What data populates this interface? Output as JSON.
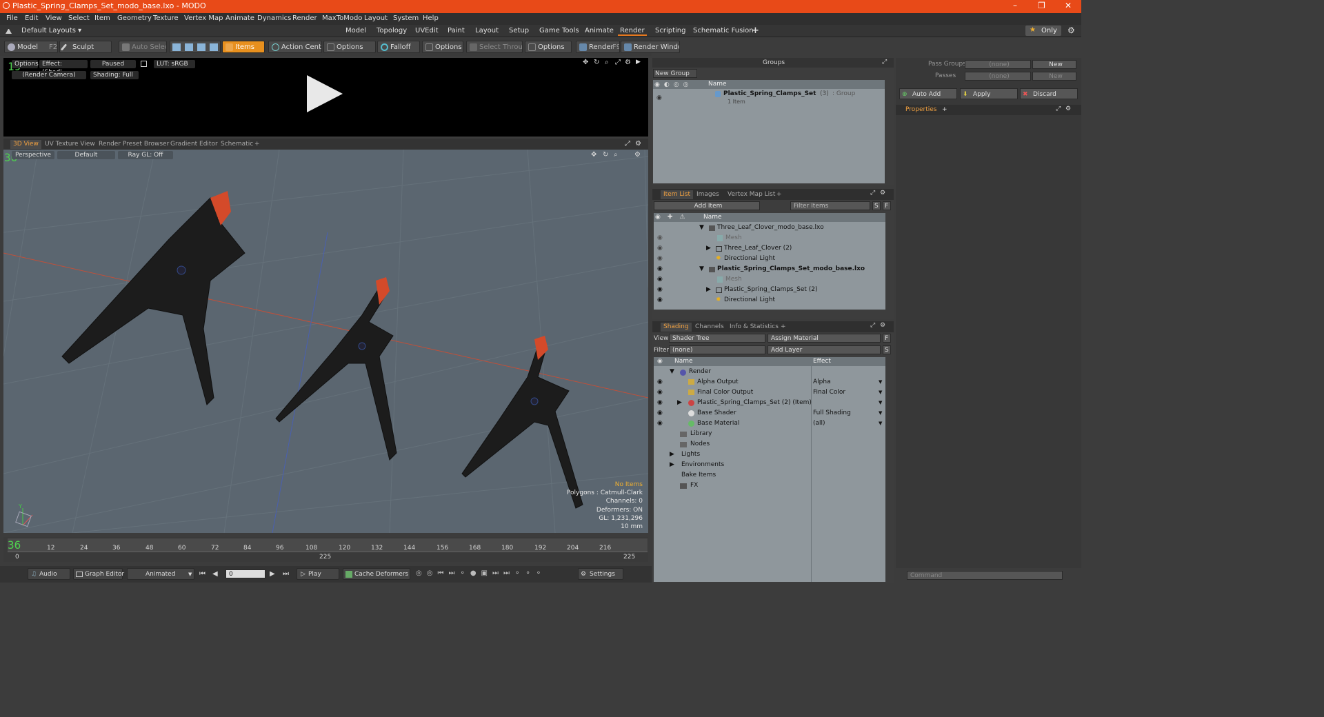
{
  "window": {
    "title": "Plastic_Spring_Clamps_Set_modo_base.lxo - MODO",
    "minimize": "–",
    "restore": "❐",
    "close": "✕"
  },
  "menu": [
    "File",
    "Edit",
    "View",
    "Select",
    "Item",
    "Geometry",
    "Texture",
    "Vertex Map",
    "Animate",
    "Dynamics",
    "Render",
    "MaxToModo",
    "Layout",
    "System",
    "Help"
  ],
  "layouts": {
    "label": "Default Layouts ▾",
    "tabs": [
      "Model",
      "Topology",
      "UVEdit",
      "Paint",
      "Layout",
      "Setup",
      "Game Tools",
      "Animate",
      "Render",
      "Scripting",
      "Schematic Fusion"
    ],
    "active": "Render",
    "only": "Only",
    "add": "+"
  },
  "toolbar": {
    "model": "Model",
    "model_key": "F2",
    "sculpt": "Sculpt",
    "auto_select": "Auto Select",
    "items": "Items",
    "action_center": "Action Center",
    "options1": "Options",
    "falloff": "Falloff",
    "options2": "Options",
    "select_through": "Select Through",
    "options3": "Options",
    "render": "Render",
    "render_key": "F9",
    "render_window": "Render Window"
  },
  "render_view": {
    "options": "Options",
    "effect": "Effect: (Shadi...",
    "paused": "Paused",
    "lut": "LUT: sRGB",
    "camera": "(Render Camera)",
    "shading": "Shading: Full"
  },
  "viewport_tabs": [
    "3D View",
    "UV Texture View",
    "Render Preset Browser",
    "Gradient Editor",
    "Schematic",
    "+"
  ],
  "viewport": {
    "perspective": "Perspective",
    "default": "Default",
    "raygl": "Ray GL: Off",
    "no_items": "No Items",
    "polygons": "Polygons : Catmull-Clark",
    "channels": "Channels: 0",
    "deformers": "Deformers: ON",
    "gl": "GL: 1,231,296",
    "mm": "10 mm",
    "axis_y": "Y"
  },
  "timeline": {
    "ticks": [
      "12",
      "24",
      "36",
      "48",
      "60",
      "72",
      "84",
      "96",
      "108",
      "120",
      "132",
      "144",
      "156",
      "168",
      "180",
      "192",
      "204",
      "216"
    ],
    "start": "0",
    "mid": "225",
    "end": "225"
  },
  "bottombar": {
    "audio": "Audio",
    "graph_editor": "Graph Editor",
    "animated": "Animated",
    "frame": "0",
    "play": "Play",
    "cache": "Cache Deformers",
    "settings": "Settings"
  },
  "groups": {
    "title": "Groups",
    "new_group": "New Group",
    "col_name": "Name",
    "item": "Plastic_Spring_Clamps_Set",
    "count": "(3)",
    "type": ": Group",
    "sub": "1 Item"
  },
  "passes": {
    "pass_groups": "Pass Groups",
    "passes": "Passes",
    "none": "(none)",
    "new": "New",
    "auto_add": "Auto Add",
    "apply": "Apply",
    "discard": "Discard",
    "properties": "Properties",
    "plus": "+"
  },
  "item_list": {
    "tabs": [
      "Item List",
      "Images",
      "Vertex Map List",
      "+"
    ],
    "add_item": "Add Item",
    "filter": "Filter Items",
    "s": "S",
    "f": "F",
    "col_name": "Name",
    "rows": [
      {
        "label": "Three_Leaf_Clover_modo_base.lxo",
        "indent": 0,
        "bold": false,
        "dim": false
      },
      {
        "label": "Mesh",
        "indent": 1,
        "bold": false,
        "dim": true
      },
      {
        "label": "Three_Leaf_Clover (2)",
        "indent": 1,
        "bold": false,
        "dim": false
      },
      {
        "label": "Directional Light",
        "indent": 1,
        "bold": false,
        "dim": false
      },
      {
        "label": "Plastic_Spring_Clamps_Set_modo_base.lxo",
        "indent": 0,
        "bold": true,
        "dim": false
      },
      {
        "label": "Mesh",
        "indent": 1,
        "bold": false,
        "dim": true
      },
      {
        "label": "Plastic_Spring_Clamps_Set (2)",
        "indent": 1,
        "bold": false,
        "dim": false
      },
      {
        "label": "Directional Light",
        "indent": 1,
        "bold": false,
        "dim": false
      }
    ]
  },
  "shading": {
    "tabs": [
      "Shading",
      "Channels",
      "Info & Statistics",
      "+"
    ],
    "view_label": "View",
    "view_value": "Shader Tree",
    "assign_material": "Assign Material",
    "filter_label": "Filter",
    "filter_value": "(none)",
    "add_layer": "Add Layer",
    "col_name": "Name",
    "col_effect": "Effect",
    "rows": [
      {
        "name": "Render",
        "effect": "",
        "indent": 0
      },
      {
        "name": "Alpha Output",
        "effect": "Alpha",
        "indent": 1
      },
      {
        "name": "Final Color Output",
        "effect": "Final Color",
        "indent": 1
      },
      {
        "name": "Plastic_Spring_Clamps_Set (2) (Item)",
        "effect": "",
        "indent": 1
      },
      {
        "name": "Base Shader",
        "effect": "Full Shading",
        "indent": 1
      },
      {
        "name": "Base Material",
        "effect": "(all)",
        "indent": 1
      },
      {
        "name": "Library",
        "effect": "",
        "indent": 1
      },
      {
        "name": "Nodes",
        "effect": "",
        "indent": 1
      },
      {
        "name": "Lights",
        "effect": "",
        "indent": 0
      },
      {
        "name": "Environments",
        "effect": "",
        "indent": 0
      },
      {
        "name": "Bake Items",
        "effect": "",
        "indent": 0
      },
      {
        "name": "FX",
        "effect": "",
        "indent": 0
      }
    ]
  },
  "command": {
    "placeholder": "Command"
  },
  "colors": {
    "accent": "#e8901e",
    "title": "#e84a18"
  }
}
